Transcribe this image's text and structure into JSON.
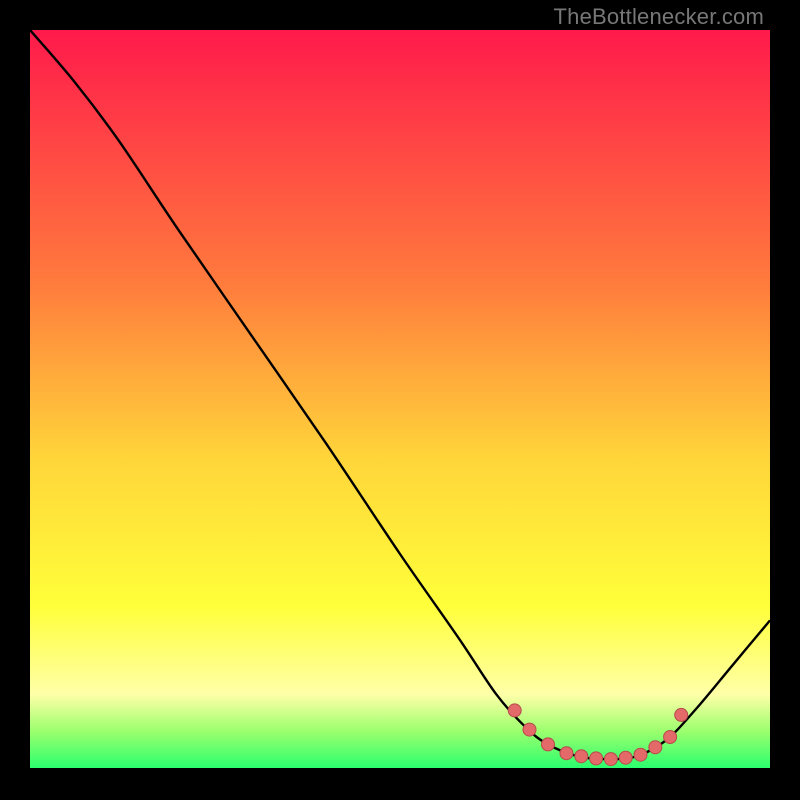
{
  "watermark": "TheBottlenecker.com",
  "colors": {
    "top": "#ff1a4b",
    "mid_upper": "#ff7a3d",
    "mid": "#ffd53a",
    "mid_lower": "#ffff3a",
    "pale_yellow": "#ffffa8",
    "green_light": "#9cff6e",
    "green": "#2bff6e",
    "curve": "#000000",
    "marker": "#e46a6a",
    "marker_stroke": "#b64b4b",
    "frame_bg": "#000000"
  },
  "chart_data": {
    "type": "line",
    "title": "",
    "xlabel": "",
    "ylabel": "",
    "xlim": [
      0,
      100
    ],
    "ylim": [
      0,
      100
    ],
    "curve": [
      {
        "x": 0.0,
        "y": 100.0
      },
      {
        "x": 6.0,
        "y": 93.0
      },
      {
        "x": 12.0,
        "y": 85.0
      },
      {
        "x": 20.0,
        "y": 73.0
      },
      {
        "x": 30.0,
        "y": 58.5
      },
      {
        "x": 40.0,
        "y": 44.0
      },
      {
        "x": 50.0,
        "y": 29.0
      },
      {
        "x": 58.0,
        "y": 17.5
      },
      {
        "x": 63.0,
        "y": 10.0
      },
      {
        "x": 67.0,
        "y": 5.5
      },
      {
        "x": 70.0,
        "y": 3.2
      },
      {
        "x": 74.0,
        "y": 1.6
      },
      {
        "x": 78.0,
        "y": 1.2
      },
      {
        "x": 82.0,
        "y": 1.6
      },
      {
        "x": 86.0,
        "y": 3.8
      },
      {
        "x": 90.0,
        "y": 8.0
      },
      {
        "x": 95.0,
        "y": 14.0
      },
      {
        "x": 100.0,
        "y": 20.0
      }
    ],
    "markers": [
      {
        "x": 65.5,
        "y": 7.8
      },
      {
        "x": 67.5,
        "y": 5.2
      },
      {
        "x": 70.0,
        "y": 3.2
      },
      {
        "x": 72.5,
        "y": 2.0
      },
      {
        "x": 74.5,
        "y": 1.6
      },
      {
        "x": 76.5,
        "y": 1.3
      },
      {
        "x": 78.5,
        "y": 1.2
      },
      {
        "x": 80.5,
        "y": 1.4
      },
      {
        "x": 82.5,
        "y": 1.8
      },
      {
        "x": 84.5,
        "y": 2.8
      },
      {
        "x": 86.5,
        "y": 4.2
      },
      {
        "x": 88.0,
        "y": 7.2
      }
    ]
  }
}
